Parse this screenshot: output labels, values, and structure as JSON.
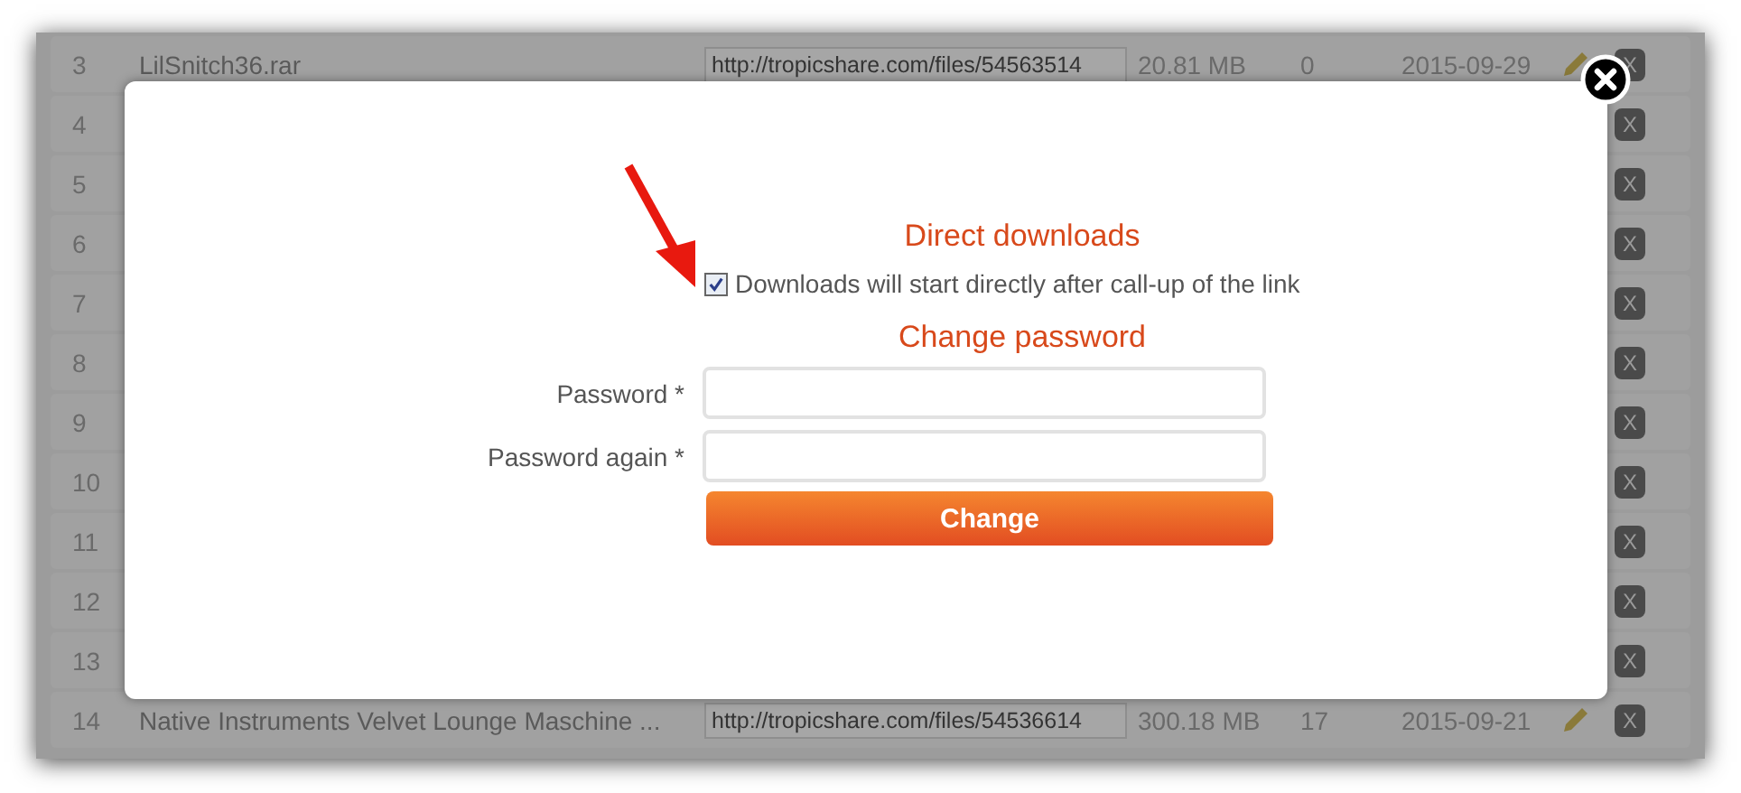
{
  "table": {
    "rows": [
      {
        "number": "3",
        "name": "LilSnitch36.rar",
        "url": "http://tropicshare.com/files/54563514",
        "size": "20.81 MB",
        "downloads": "0",
        "date": "2015-09-29",
        "delete": "X"
      },
      {
        "number": "4",
        "delete": "X"
      },
      {
        "number": "5",
        "delete": "X"
      },
      {
        "number": "6",
        "delete": "X"
      },
      {
        "number": "7",
        "delete": "X"
      },
      {
        "number": "8",
        "delete": "X"
      },
      {
        "number": "9",
        "delete": "X"
      },
      {
        "number": "10",
        "delete": "X"
      },
      {
        "number": "11",
        "delete": "X"
      },
      {
        "number": "12",
        "delete": "X"
      },
      {
        "number": "13",
        "delete": "X"
      },
      {
        "number": "14",
        "name": "Native Instruments Velvet Lounge Maschine ...",
        "url": "http://tropicshare.com/files/54536614",
        "size": "300.18 MB",
        "downloads": "17",
        "date": "2015-09-21",
        "delete": "X"
      }
    ]
  },
  "dialog": {
    "direct_title": "Direct downloads",
    "direct_checkbox": {
      "label": "Downloads will start directly after call-up of the link",
      "checked": true
    },
    "password_title": "Change password",
    "fields": [
      {
        "label": "Password *"
      },
      {
        "label": "Password again *"
      }
    ],
    "submit": "Change"
  }
}
